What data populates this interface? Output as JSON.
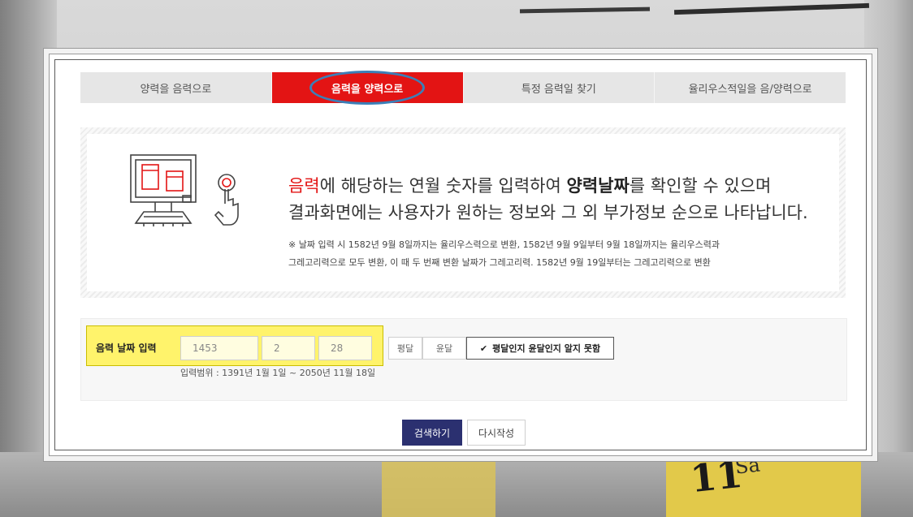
{
  "tabs": [
    {
      "label": "양력을 음력으로",
      "active": false
    },
    {
      "label": "음력을 양력으로",
      "active": true
    },
    {
      "label": "특정 음력일 찾기",
      "active": false
    },
    {
      "label": "율리우스적일을 음/양력으로",
      "active": false
    }
  ],
  "info": {
    "headline_red": "음력",
    "headline_part1": "에 해당하는 연월 숫자를 입력하여 ",
    "headline_bold": "양력날짜",
    "headline_part2": "를 확인할 수 있으며",
    "headline_line2": "결과화면에는 사용자가 원하는 정보와 그 외 부가정보 순으로 나타납니다.",
    "note_line1": "※ 날짜 입력 시 1582년 9월 8일까지는 율리우스력으로 변환, 1582년 9월 9일부터 9월 18일까지는 율리우스력과",
    "note_line2": "그레고리력으로 모두 변환, 이 때 두 번째 변환 날짜가 그레고리력. 1582년 9월 19일부터는 그레고리력으로 변환"
  },
  "form": {
    "label": "음력 날짜 입력",
    "year": "1453",
    "month": "2",
    "day": "28",
    "option_normal": "평달",
    "option_leap": "윤달",
    "option_unknown": "평달인지 윤달인지 알지 못함",
    "range": "입력범위 : 1391년 1월 1일 ~ 2050년 11월 18일"
  },
  "buttons": {
    "search": "검색하기",
    "reset": "다시작성"
  },
  "background": {
    "number": "11",
    "small": "Sa"
  },
  "colors": {
    "active_tab": "#e31414",
    "search_button": "#2b3070",
    "highlight": "#fff36b",
    "circle": "#3b7fb8"
  }
}
